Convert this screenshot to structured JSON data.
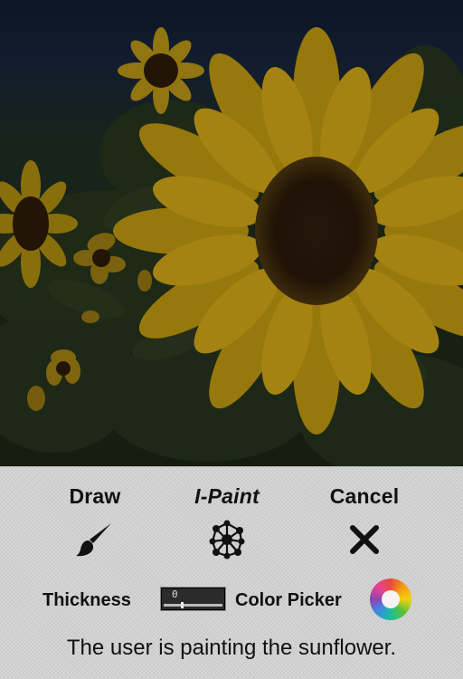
{
  "photo": {
    "subject": "sunflower field"
  },
  "toolbar": {
    "draw_label": "Draw",
    "ipaint_label": "I-Paint",
    "cancel_label": "Cancel"
  },
  "thickness": {
    "label": "Thickness",
    "value": "0"
  },
  "color_picker": {
    "label": "Color Picker"
  },
  "status_text": "The user is painting the sunflower.",
  "colors": {
    "panel_bg": "#d2d2d2",
    "slider_bg": "#2b2b2b",
    "petal": "#c9a016",
    "sunflower_center": "#2a1a08"
  },
  "icons": {
    "draw": "paintbrush-icon",
    "ipaint": "node-graph-icon",
    "cancel": "close-icon",
    "color_picker": "color-wheel-icon"
  }
}
